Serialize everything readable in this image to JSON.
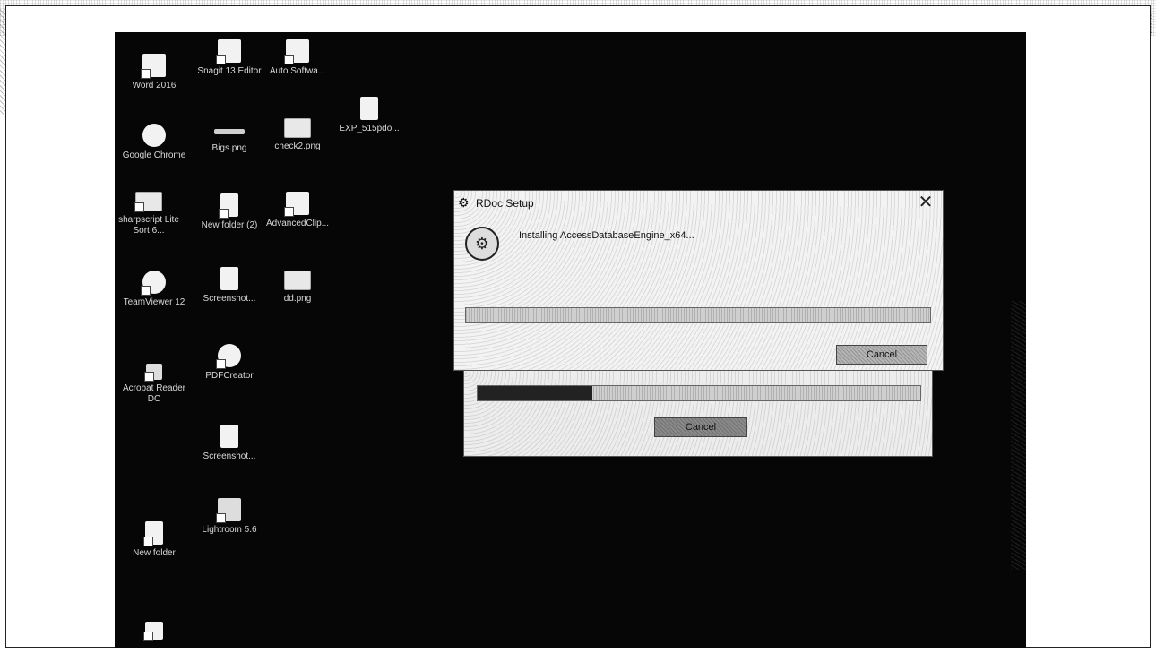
{
  "desktop": {
    "icons": [
      {
        "label": "Word 2016"
      },
      {
        "label": "Snagit 13 Editor"
      },
      {
        "label": "Auto Softwa..."
      },
      {
        "label": "Google Chrome"
      },
      {
        "label": "Bigs.png"
      },
      {
        "label": "check2.png"
      },
      {
        "label": "EXP_515pdo..."
      },
      {
        "label": "sharpscript Lite Sort 6..."
      },
      {
        "label": "New folder (2)"
      },
      {
        "label": "AdvancedClip..."
      },
      {
        "label": "TeamViewer 12"
      },
      {
        "label": "Screenshot..."
      },
      {
        "label": "dd.png"
      },
      {
        "label": "Acrobat Reader DC"
      },
      {
        "label": "PDFCreator"
      },
      {
        "label": "Screenshot..."
      },
      {
        "label": "Lightroom 5.6"
      },
      {
        "label": "New folder"
      },
      {
        "label": ""
      }
    ]
  },
  "dialog": {
    "title": "RDoc Setup",
    "close_glyph": "✕",
    "status_text": "Installing AccessDatabaseEngine_x64...",
    "progress": 0.0,
    "cancel_label": "Cancel"
  },
  "background_window": {
    "progress": 0.26,
    "cancel_label": "Cancel"
  }
}
